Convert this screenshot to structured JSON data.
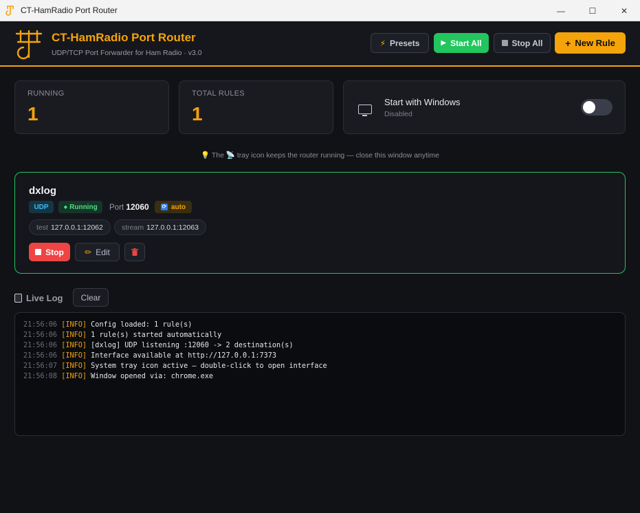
{
  "window": {
    "title": "CT-HamRadio Port Router",
    "controls": {
      "minimize": "—",
      "maximize": "☐",
      "close": "✕"
    }
  },
  "header": {
    "title": "CT-HamRadio Port Router",
    "subtitle": "UDP/TCP Port Forwarder for Ham Radio · v3.0",
    "buttons": {
      "presets": {
        "icon": "lightning-icon",
        "label": "Presets"
      },
      "start_all": {
        "icon": "play-icon",
        "label": "Start All"
      },
      "stop_all": {
        "icon": "stop-square-icon",
        "label": "Stop All"
      },
      "new_rule": {
        "icon": "plus-icon",
        "label": "New Rule"
      }
    }
  },
  "stats": {
    "running": {
      "label": "RUNNING",
      "value": "1"
    },
    "total_rules": {
      "label": "TOTAL RULES",
      "value": "1"
    }
  },
  "startup": {
    "icon": "monitor-icon",
    "title": "Start with Windows",
    "status": "Disabled",
    "enabled": false
  },
  "tip": {
    "prefix": "The",
    "suffix": "tray icon keeps the router running — close this window anytime"
  },
  "rules": [
    {
      "name": "dxlog",
      "protocol": "UDP",
      "status": "● Running",
      "port_label": "Port",
      "port": "12060",
      "auto_label": "auto",
      "destinations": [
        {
          "name": "test",
          "address": "127.0.0.1:12062"
        },
        {
          "name": "stream",
          "address": "127.0.0.1:12063"
        }
      ],
      "actions": {
        "stop": "Stop",
        "edit": "Edit"
      }
    }
  ],
  "log": {
    "title": "Live Log",
    "clear_label": "Clear",
    "entries": [
      {
        "time": "21:56:06",
        "level": "[INFO]",
        "message": "Config loaded: 1 rule(s)"
      },
      {
        "time": "21:56:06",
        "level": "[INFO]",
        "message": "1 rule(s) started automatically"
      },
      {
        "time": "21:56:06",
        "level": "[INFO]",
        "message": "[dxlog] UDP listening :12060 -> 2 destination(s)"
      },
      {
        "time": "21:56:06",
        "level": "[INFO]",
        "message": "Interface available at http://127.0.0.1:7373"
      },
      {
        "time": "21:56:07",
        "level": "[INFO]",
        "message": "System tray icon active — double-click to open interface"
      },
      {
        "time": "21:56:08",
        "level": "[INFO]",
        "message": "Window opened via: chrome.exe"
      }
    ]
  },
  "colors": {
    "accent": "#f5a30a",
    "running": "#22c55e",
    "danger": "#ef4444",
    "udp": "#38bdf8"
  }
}
